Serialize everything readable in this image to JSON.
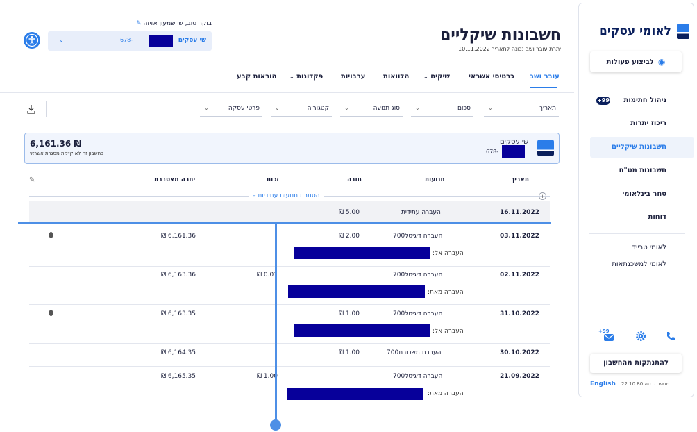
{
  "sidebar": {
    "brand": "לאומי עסקים",
    "action_button": "לביצוע פעולות",
    "items": [
      {
        "label": "ניהול חתימות",
        "badge": "+99"
      },
      {
        "label": "ריכוז יתרות"
      },
      {
        "label": "חשבונות שיקליים",
        "active": true
      },
      {
        "label": "חשבונות מט\"ח"
      },
      {
        "label": "סחר בינלאומי"
      },
      {
        "label": "דוחות"
      }
    ],
    "links": [
      "לאומי טרייד",
      "לאומי למשכנתאות"
    ],
    "notification_badge": "+99",
    "disconnect": "להתנתקות מהחשבון",
    "language": "English",
    "version": "מספר גרסה 22.10.80"
  },
  "header": {
    "title": "חשבונות שיקליים",
    "balance_note": "יתרת עובר ושב נכונה לתאריך 10.11.2022",
    "greeting": "בוקר טוב, שי שמעון אזיזה",
    "account_name": "שי עסקים",
    "account_number_suffix": "678-"
  },
  "tabs": [
    {
      "label": "עובר ושב",
      "active": true
    },
    {
      "label": "כרטיסי אשראי"
    },
    {
      "label": "שיקים",
      "dropdown": true
    },
    {
      "label": "הלוואות"
    },
    {
      "label": "ערבויות"
    },
    {
      "label": "פקדונות",
      "dropdown": true
    },
    {
      "label": "הוראות קבע"
    }
  ],
  "filters": [
    {
      "label": "תאריך"
    },
    {
      "label": "סכום"
    },
    {
      "label": "סוג תנועה"
    },
    {
      "label": "קטגוריה"
    },
    {
      "label": "פרטי עסקה"
    }
  ],
  "summary": {
    "account_name": "שי עסקים",
    "account_number_suffix": "678-",
    "balance": "6,161.36 ₪",
    "note": "בחשבון זה לא קיימת מסגרת אשראי"
  },
  "table": {
    "headers": {
      "date": "תאריך",
      "desc": "תנועות",
      "debit": "חובה",
      "credit": "זכות",
      "balance": "יתרה מצטברת"
    },
    "toggle_future": "הסתרת תנועות עתידיות",
    "future_row": {
      "date": "16.11.2022",
      "desc": "העברה עתידית",
      "debit": "5.00 ₪"
    },
    "rows": [
      {
        "date": "03.11.2022",
        "desc": "העברה דיגיטל700",
        "debit": "2.00 ₪",
        "credit": "",
        "balance": "6,161.36 ₪",
        "sub": "העברה אל:",
        "attachment": true
      },
      {
        "date": "02.11.2022",
        "desc": "העברה דיגיטל700",
        "debit": "",
        "credit": "0.01 ₪",
        "balance": "6,163.36 ₪",
        "sub": "העברה מאת:",
        "attachment": false
      },
      {
        "date": "31.10.2022",
        "desc": "העברה דיגיטל700",
        "debit": "1.00 ₪",
        "credit": "",
        "balance": "6,163.35 ₪",
        "sub": "העברה אל:",
        "attachment": true
      },
      {
        "date": "30.10.2022",
        "desc": "העברת משכורת700",
        "debit": "1.00 ₪",
        "credit": "",
        "balance": "6,164.35 ₪",
        "sub": "",
        "attachment": false
      },
      {
        "date": "21.09.2022",
        "desc": "העברה דיגיטל700",
        "debit": "",
        "credit": "1.00 ₪",
        "balance": "6,165.35 ₪",
        "sub": "העברה מאת:",
        "attachment": false
      }
    ]
  },
  "colors": {
    "accent": "#2b7de9",
    "brand_dark": "#0a1f5c",
    "redaction": "#07009a",
    "overlay_line": "#4d8fe6"
  }
}
